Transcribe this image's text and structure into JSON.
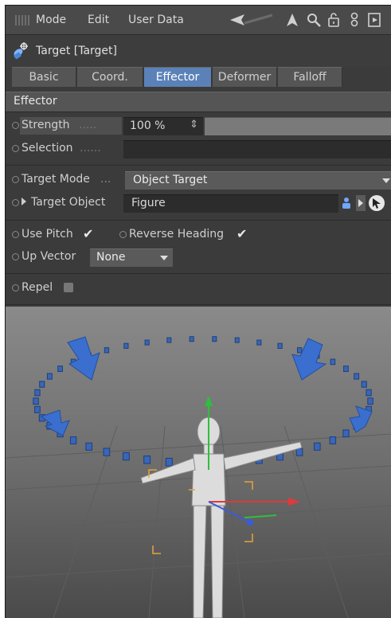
{
  "menubar": {
    "items": [
      "Mode",
      "Edit",
      "User Data"
    ],
    "icons": [
      "back-arrow-icon",
      "up-arrow-icon",
      "search-icon",
      "lock-icon",
      "hierarchy-icon",
      "new-window-icon"
    ]
  },
  "object": {
    "title": "Target [Target]",
    "icon": "target-effector-icon"
  },
  "tabs": [
    {
      "label": "Basic",
      "active": false
    },
    {
      "label": "Coord.",
      "active": false
    },
    {
      "label": "Effector",
      "active": true
    },
    {
      "label": "Deformer",
      "active": false
    },
    {
      "label": "Falloff",
      "active": false
    }
  ],
  "section": {
    "title": "Effector"
  },
  "fields": {
    "strength_label": "Strength",
    "strength_dots": ".....",
    "strength_value": "100 %",
    "strength_fraction": 1.0,
    "selection_label": "Selection",
    "selection_dots": "......",
    "selection_value": "",
    "target_mode_label": "Target Mode",
    "target_mode_dots": "...",
    "target_mode_value": "Object Target",
    "target_object_label": "Target Object",
    "target_object_value": "Figure",
    "use_pitch_label": "Use Pitch",
    "use_pitch_checked": true,
    "reverse_heading_label": "Reverse Heading",
    "reverse_heading_checked": true,
    "up_vector_label": "Up Vector",
    "up_vector_value": "None",
    "repel_label": "Repel",
    "repel_checked": false
  },
  "colors": {
    "panel_bg": "#3b3b3b",
    "tab_active": "#5b82b8",
    "viewport_bg": "#6b6b6b",
    "clone_blue": "#3a66b8"
  }
}
